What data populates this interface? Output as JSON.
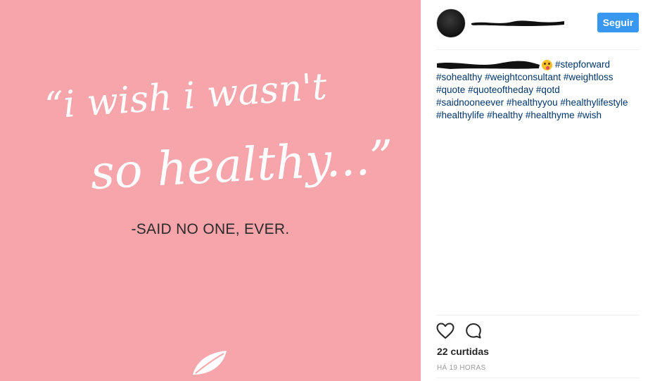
{
  "post": {
    "quote_line1": "“i wish i wasn't",
    "quote_line2": "so healthy...”",
    "attribution": "-SAID NO ONE, EVER.",
    "logo_icon": "leaf-icon"
  },
  "header": {
    "avatar_icon": "avatar",
    "follow_label": "Seguir",
    "follow_color": "#3897f0"
  },
  "caption": {
    "emoji": "emoji-icon",
    "hashtags": [
      "#stepforward",
      "#sohealthy",
      "#weightconsultant",
      "#weightloss",
      "#quote",
      "#quoteoftheday",
      "#qotd",
      "#saidnooneever",
      "#healthyyou",
      "#healthylifestyle",
      "#healthylife",
      "#healthy",
      "#healthyme",
      "#wish"
    ]
  },
  "actions": {
    "like_icon": "heart-icon",
    "comment_icon": "comment-icon"
  },
  "likes": "22 curtidas",
  "timestamp": "HÁ 19 HORAS",
  "colors": {
    "image_background": "#f6a5ab",
    "hashtag_link": "#003569"
  }
}
